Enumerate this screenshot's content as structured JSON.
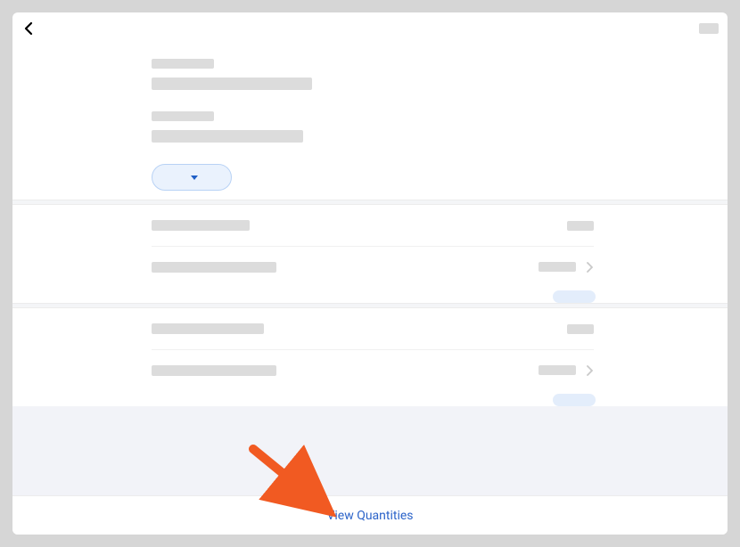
{
  "header": {
    "back_icon": "chevron-left"
  },
  "dropdown": {
    "selected": ""
  },
  "footer": {
    "link_label": "View Quantities"
  },
  "annotation": {
    "arrow_color": "#f15a22"
  }
}
